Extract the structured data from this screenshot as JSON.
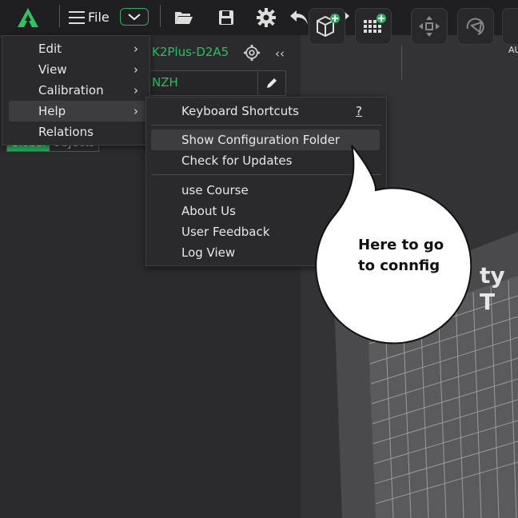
{
  "topbar": {
    "file_label": "File",
    "icons": [
      "app-logo-icon",
      "hamburger-icon",
      "chevron-down-icon",
      "folder-open-icon",
      "save-icon",
      "gear-icon",
      "undo-icon",
      "redo-icon"
    ]
  },
  "sidebar": {
    "printer_name": "K2Plus-D2A5",
    "filament_value": "NZH",
    "tabs": {
      "global": "Global",
      "objects": "Objects"
    }
  },
  "main_menu": {
    "items": [
      {
        "label": "Edit",
        "has_submenu": true
      },
      {
        "label": "View",
        "has_submenu": true
      },
      {
        "label": "Calibration",
        "has_submenu": true
      },
      {
        "label": "Help",
        "has_submenu": true
      },
      {
        "label": "Relations",
        "has_submenu": false
      }
    ]
  },
  "help_menu": {
    "items": [
      {
        "label": "Keyboard Shortcuts",
        "shortcut": "?"
      },
      {
        "label": "Show Configuration Folder"
      },
      {
        "label": "Check for Updates"
      },
      {
        "label": "use Course"
      },
      {
        "label": "About Us"
      },
      {
        "label": "User Feedback"
      },
      {
        "label": "Log View"
      }
    ]
  },
  "callout": {
    "text": "Here to go\nto connfig"
  },
  "viewport": {
    "auto_label": "AU",
    "bed_text": "ty T"
  },
  "colors": {
    "accent": "#26c05e",
    "menu_bg": "#2a2a2c",
    "topbar_bg": "#1f1f21"
  }
}
